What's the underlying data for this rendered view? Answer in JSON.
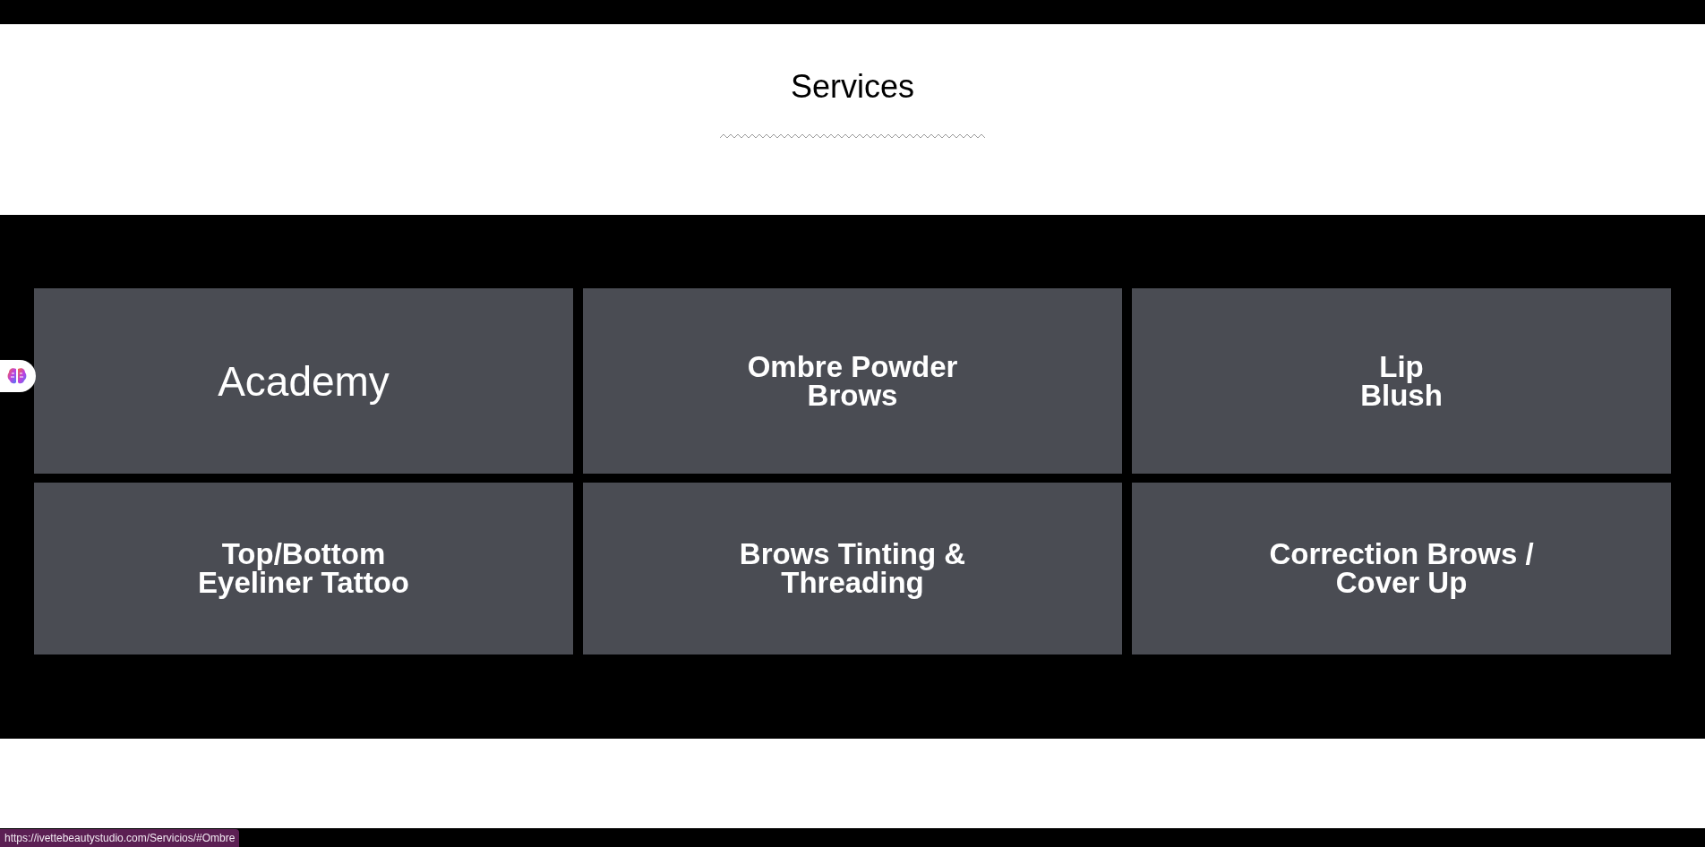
{
  "section_title": "Services",
  "services": [
    {
      "kind": "light",
      "lines": [
        "Academy"
      ]
    },
    {
      "kind": "bold",
      "lines": [
        "Ombre Powder",
        "Brows"
      ]
    },
    {
      "kind": "bold",
      "lines": [
        "Lip",
        "Blush"
      ]
    },
    {
      "kind": "bold",
      "lines": [
        "Top/Bottom",
        "Eyeliner Tattoo"
      ]
    },
    {
      "kind": "bold",
      "lines": [
        "Brows Tinting &",
        "Threading"
      ]
    },
    {
      "kind": "bold",
      "lines": [
        "Correction Brows /",
        "Cover Up"
      ]
    }
  ],
  "status_bar": {
    "url": "https://ivettebeautystudio.com/Servicios/#Ombre"
  }
}
